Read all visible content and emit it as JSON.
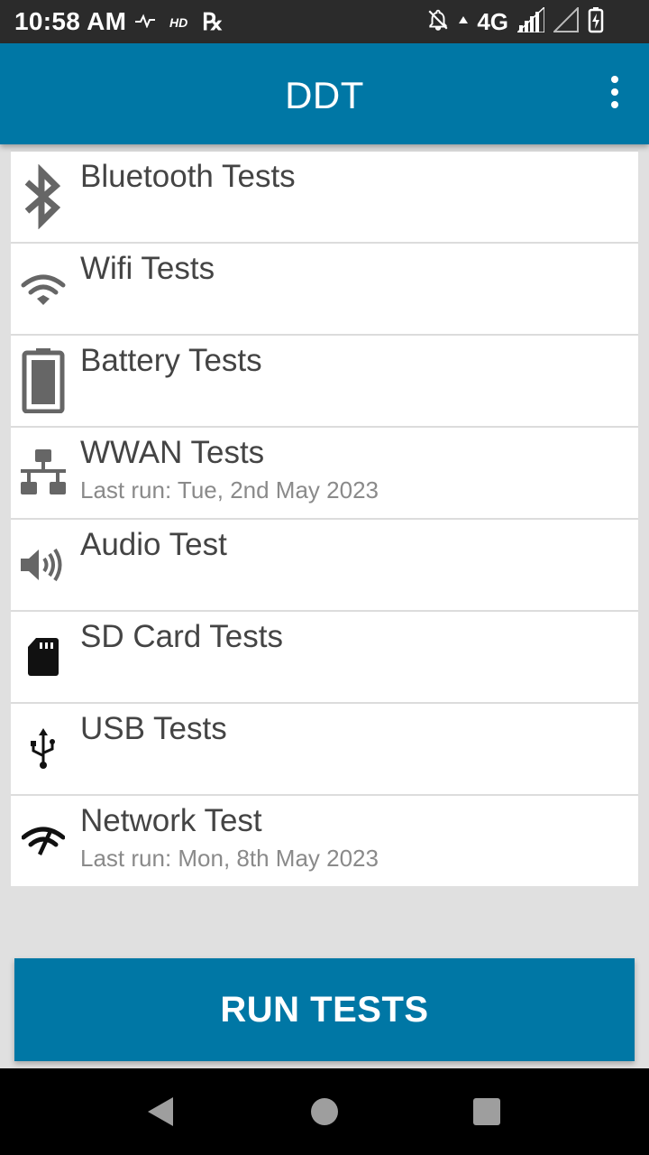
{
  "status_bar": {
    "time": "10:58 AM",
    "hd_label": "HD",
    "rx_label": "℞",
    "network_label": "4G",
    "icons": [
      "pulse-icon",
      "hd-icon",
      "rx-icon",
      "notifications-off-icon",
      "signal-icon",
      "no-signal-icon",
      "battery-charging-icon"
    ]
  },
  "app_bar": {
    "title": "DDT",
    "menu_icon": "overflow-menu-icon"
  },
  "tests": [
    {
      "title": "Bluetooth Tests",
      "subtitle": "",
      "icon": "bluetooth-icon"
    },
    {
      "title": "Wifi Tests",
      "subtitle": "",
      "icon": "wifi-icon"
    },
    {
      "title": "Battery Tests",
      "subtitle": "",
      "icon": "battery-icon"
    },
    {
      "title": "WWAN Tests",
      "subtitle": "Last run: Tue, 2nd May 2023",
      "icon": "network-tree-icon"
    },
    {
      "title": "Audio Test",
      "subtitle": "",
      "icon": "speaker-icon"
    },
    {
      "title": "SD Card Tests",
      "subtitle": "",
      "icon": "sd-card-icon"
    },
    {
      "title": "USB Tests",
      "subtitle": "",
      "icon": "usb-icon"
    },
    {
      "title": "Network Test",
      "subtitle": "Last run: Mon, 8th May 2023",
      "icon": "network-check-icon"
    }
  ],
  "run_button": {
    "label": "RUN TESTS"
  },
  "colors": {
    "primary": "#0077a5",
    "status_bar": "#2b2b2b",
    "background": "#e0e0e0",
    "icon_gray": "#666666"
  }
}
